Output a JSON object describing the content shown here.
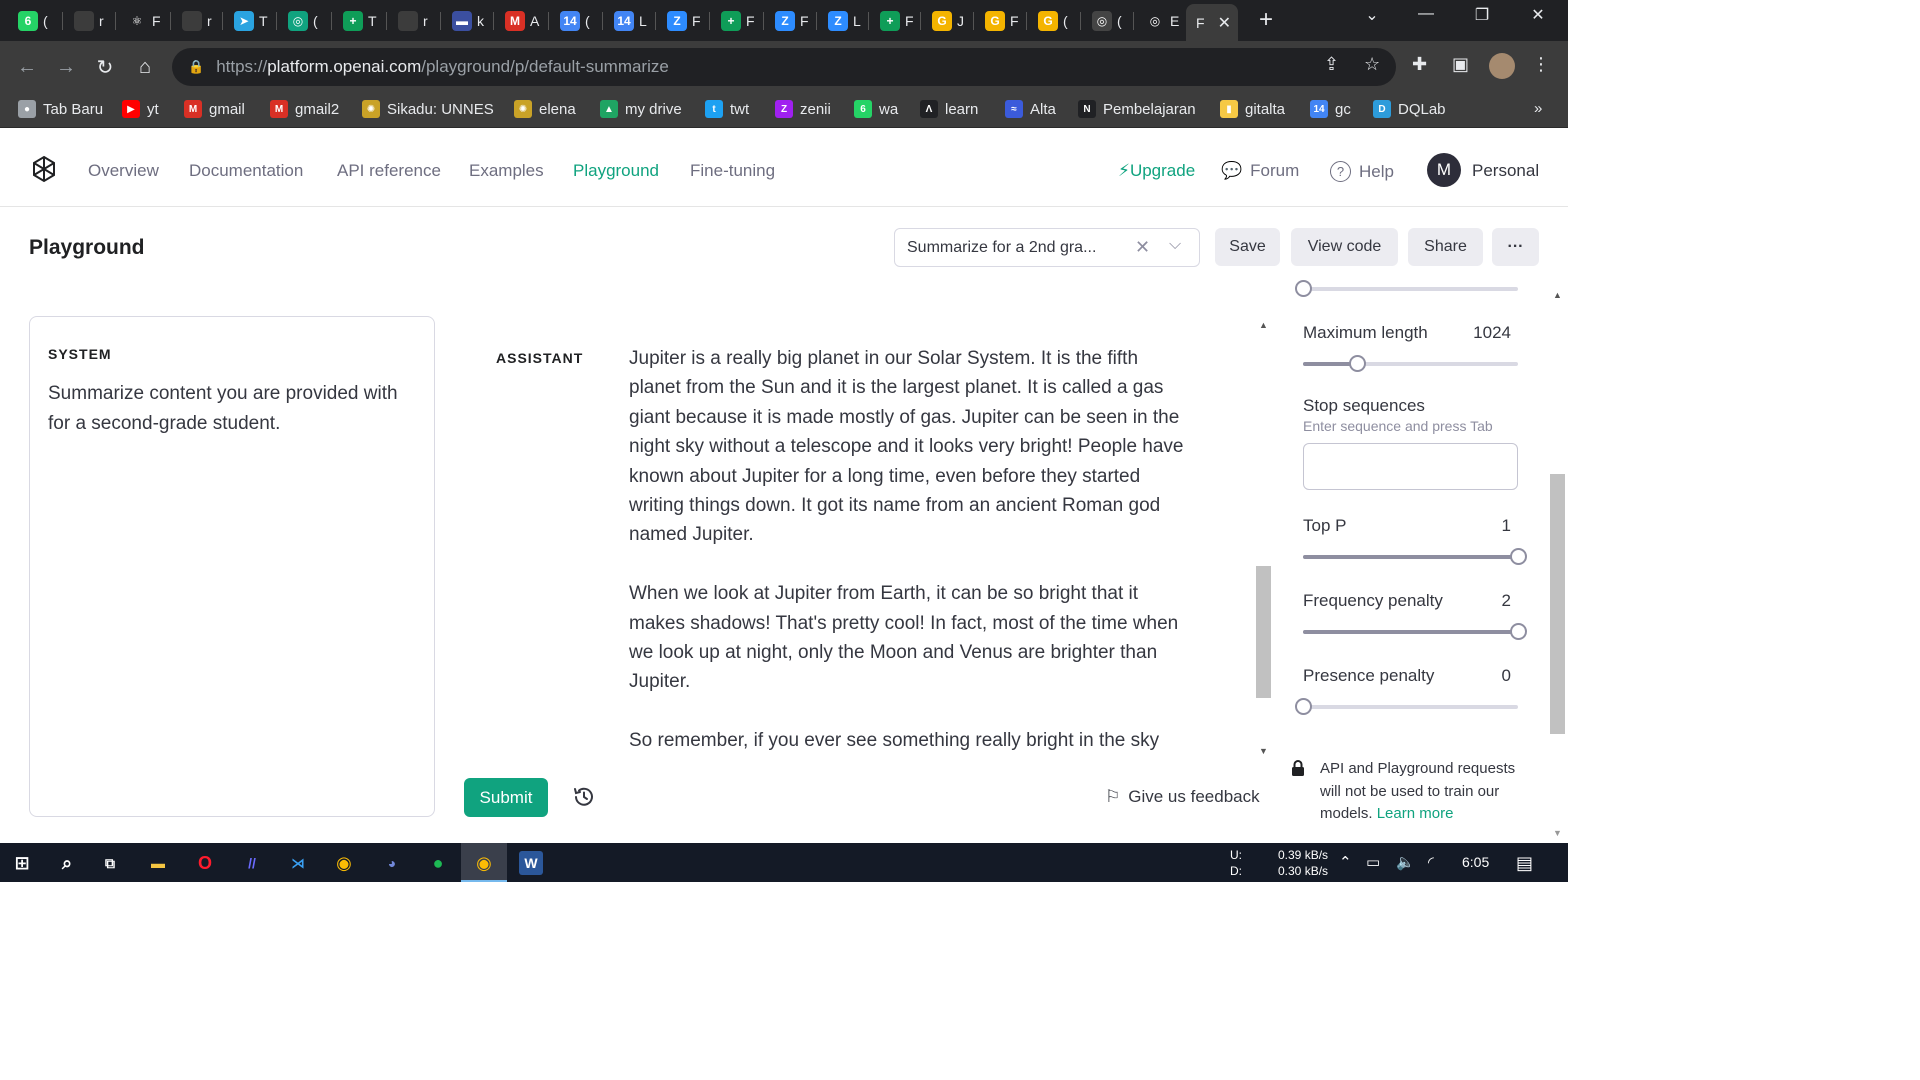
{
  "browser": {
    "tabs": [
      {
        "fav": "6",
        "color": "#25d366",
        "text": "("
      },
      {
        "fav": "",
        "color": "#3c3c3c",
        "text": "r"
      },
      {
        "fav": "⚛",
        "color": "#202124",
        "text": "F"
      },
      {
        "fav": "",
        "color": "#3c3c3c",
        "text": "r"
      },
      {
        "fav": "➤",
        "color": "#2aa3e0",
        "text": "T"
      },
      {
        "fav": "◎",
        "color": "#10a37f",
        "text": "("
      },
      {
        "fav": "+",
        "color": "#0f9d58",
        "text": "T"
      },
      {
        "fav": "",
        "color": "#3c3c3c",
        "text": "r"
      },
      {
        "fav": "▬",
        "color": "#3b4fa0",
        "text": "k"
      },
      {
        "fav": "M",
        "color": "#d93025",
        "text": "A"
      },
      {
        "fav": "14",
        "color": "#4285f4",
        "text": "("
      },
      {
        "fav": "14",
        "color": "#4285f4",
        "text": "L"
      },
      {
        "fav": "Z",
        "color": "#2d8cff",
        "text": "F"
      },
      {
        "fav": "+",
        "color": "#0f9d58",
        "text": "F"
      },
      {
        "fav": "Z",
        "color": "#2d8cff",
        "text": "F"
      },
      {
        "fav": "Z",
        "color": "#2d8cff",
        "text": "L"
      },
      {
        "fav": "+",
        "color": "#0f9d58",
        "text": "F"
      },
      {
        "fav": "G",
        "color": "#f4b400",
        "text": "J"
      },
      {
        "fav": "G",
        "color": "#f4b400",
        "text": "F"
      },
      {
        "fav": "G",
        "color": "#f4b400",
        "text": "("
      },
      {
        "fav": "◎",
        "color": "#444",
        "text": "("
      },
      {
        "fav": "◎",
        "color": "#202124",
        "text": "E"
      }
    ],
    "active_tab": {
      "text": "F"
    },
    "url_prefix": "https://",
    "url_host": "platform.openai.com",
    "url_path": "/playground/p/default-summarize",
    "bookmarks": [
      {
        "label": "Tab Baru",
        "fav": "●",
        "color": "#9aa0a6"
      },
      {
        "label": "yt",
        "fav": "▶",
        "color": "#ff0000"
      },
      {
        "label": "gmail",
        "fav": "M",
        "color": "#d93025"
      },
      {
        "label": "gmail2",
        "fav": "M",
        "color": "#d93025"
      },
      {
        "label": "Sikadu: UNNES",
        "fav": "✺",
        "color": "#c9a227"
      },
      {
        "label": "elena",
        "fav": "✺",
        "color": "#c9a227"
      },
      {
        "label": "my drive",
        "fav": "▲",
        "color": "#1fa463"
      },
      {
        "label": "twt",
        "fav": "t",
        "color": "#1da1f2"
      },
      {
        "label": "zenii",
        "fav": "Z",
        "color": "#a020f0"
      },
      {
        "label": "wa",
        "fav": "6",
        "color": "#25d366"
      },
      {
        "label": "learn",
        "fav": "Λ",
        "color": "#202124"
      },
      {
        "label": "Alta",
        "fav": "≈",
        "color": "#3b5bdb"
      },
      {
        "label": "Pembelajaran",
        "fav": "N",
        "color": "#202124"
      },
      {
        "label": "gitalta",
        "fav": "▮",
        "color": "#f6c945"
      },
      {
        "label": "gc",
        "fav": "14",
        "color": "#4285f4"
      },
      {
        "label": "DQLab",
        "fav": "D",
        "color": "#2d9cdb"
      }
    ],
    "more_bookmarks": "»"
  },
  "appnav": {
    "links": [
      "Overview",
      "Documentation",
      "API reference",
      "Examples",
      "Playground",
      "Fine-tuning"
    ],
    "upgrade": "Upgrade",
    "forum": "Forum",
    "help": "Help",
    "avatar_initial": "M",
    "account": "Personal"
  },
  "toolbar": {
    "title": "Playground",
    "preset": "Summarize for a 2nd gra...",
    "save": "Save",
    "view_code": "View code",
    "share": "Share",
    "more": "···"
  },
  "system": {
    "label": "SYSTEM",
    "text": "Summarize content you are provided with for a second-grade student."
  },
  "chat": {
    "role": "ASSISTANT",
    "paragraphs": [
      "Jupiter is a really big planet in our Solar System. It is the fifth planet from the Sun and it is the largest planet. It is called a gas giant because it is made mostly of gas. Jupiter can be seen in the night sky without a telescope and it looks very bright! People have known about Jupiter for a long time, even before they started writing things down. It got its name from an ancient Roman god named Jupiter.",
      "When we look at Jupiter from Earth, it can be so bright that it makes shadows! That's pretty cool! In fact, most of the time when we look up at night, only the Moon and Venus are brighter than Jupiter.",
      "So remember, if you ever see something really bright in the sky"
    ],
    "submit": "Submit",
    "feedback": "Give us feedback"
  },
  "params": {
    "max_length": {
      "label": "Maximum length",
      "value": "1024",
      "level": 0.25
    },
    "stop": {
      "label": "Stop sequences",
      "hint": "Enter sequence and press Tab",
      "value": ""
    },
    "top_p": {
      "label": "Top P",
      "value": "1",
      "level": 1.0
    },
    "frequency_penalty": {
      "label": "Frequency penalty",
      "value": "2",
      "level": 1.0
    },
    "presence_penalty": {
      "label": "Presence penalty",
      "value": "0",
      "level": 0.0
    },
    "top_slider_level": 0.0,
    "privacy_text": "API and Playground requests will not be used to train our models.",
    "privacy_link": "Learn more"
  },
  "taskbar": {
    "net_labels": [
      "U:",
      "D:"
    ],
    "net_values": [
      "0.39 kB/s",
      "0.30 kB/s"
    ],
    "time": "6:05"
  },
  "colors": {
    "accent": "#10a37f",
    "text": "#353740",
    "muted": "#6e6e80"
  }
}
